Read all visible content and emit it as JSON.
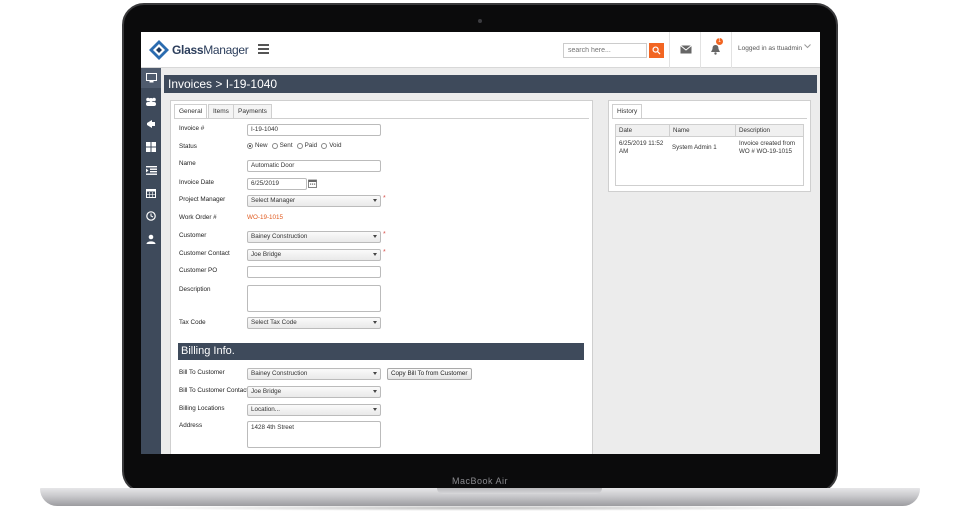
{
  "device": {
    "label": "MacBook Air"
  },
  "header": {
    "logo_text_bold": "Glass",
    "logo_text_rest": "Manager",
    "search": {
      "placeholder": "search here..."
    },
    "notification_count": "1",
    "logged_in_text": "Logged in as ttuadmin"
  },
  "sidebar": {
    "items": [
      {
        "icon": "monitor-icon"
      },
      {
        "icon": "users-icon"
      },
      {
        "icon": "megaphone-icon"
      },
      {
        "icon": "grid-icon"
      },
      {
        "icon": "list-indent-icon"
      },
      {
        "icon": "calendar-icon"
      },
      {
        "icon": "clock-icon"
      },
      {
        "icon": "user-icon"
      }
    ]
  },
  "page": {
    "breadcrumb_root": "Invoices",
    "breadcrumb_sep": ">",
    "breadcrumb_current": "I-19-1040"
  },
  "tabs": [
    {
      "label": "General",
      "active": true
    },
    {
      "label": "Items",
      "active": false
    },
    {
      "label": "Payments",
      "active": false
    }
  ],
  "form": {
    "invoice_no": {
      "label": "Invoice #",
      "value": "I-19-1040"
    },
    "status": {
      "label": "Status",
      "options": [
        "New",
        "Sent",
        "Paid",
        "Void"
      ],
      "selected": "New"
    },
    "name": {
      "label": "Name",
      "value": "Automatic Door"
    },
    "invoice_date": {
      "label": "Invoice Date",
      "value": "6/25/2019"
    },
    "project_manager": {
      "label": "Project Manager",
      "value": "Select Manager",
      "required": "*"
    },
    "work_order": {
      "label": "Work Order #",
      "value": "WO-19-1015"
    },
    "customer": {
      "label": "Customer",
      "value": "Bainey Construction",
      "required": "*"
    },
    "customer_contact": {
      "label": "Customer Contact",
      "value": "Joe Bridge",
      "required": "*"
    },
    "customer_po": {
      "label": "Customer PO",
      "value": ""
    },
    "description": {
      "label": "Description",
      "value": ""
    },
    "tax_code": {
      "label": "Tax Code",
      "value": "Select Tax Code"
    }
  },
  "billing": {
    "title": "Billing Info.",
    "bill_to_customer": {
      "label": "Bill To Customer",
      "value": "Bainey Construction"
    },
    "copy_button": "Copy Bill To from Customer",
    "bill_to_contact": {
      "label": "Bill To Customer Contact",
      "value": "Joe Bridge"
    },
    "billing_locations": {
      "label": "Billing Locations",
      "value": "Location..."
    },
    "address": {
      "label": "Address",
      "value": "1428 4th Street"
    }
  },
  "history": {
    "tab_label": "History",
    "columns": [
      "Date",
      "Name",
      "Description"
    ],
    "rows": [
      {
        "date": "6/25/2019 11:52 AM",
        "name": "System Admin 1",
        "description": "Invoice created from WO # WO-19-1015"
      }
    ]
  }
}
